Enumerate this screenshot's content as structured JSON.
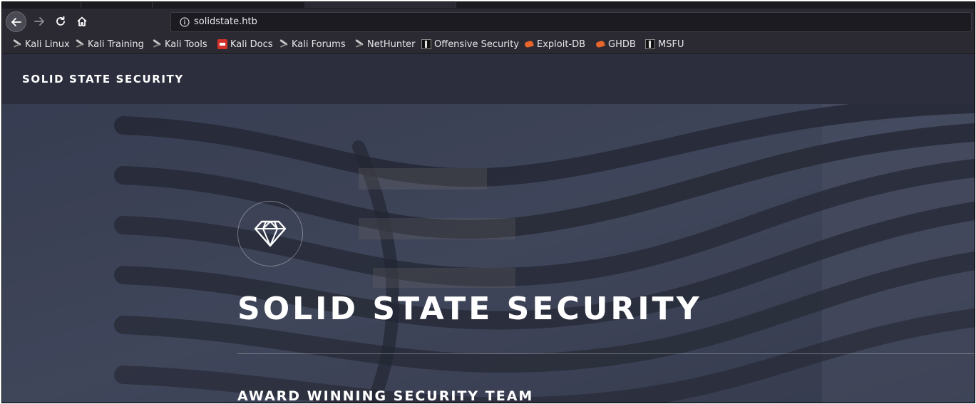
{
  "browser": {
    "url": "solidstate.htb",
    "bookmarks": [
      {
        "label": "Kali Linux",
        "icon": "kali-dragon-icon"
      },
      {
        "label": "Kali Training",
        "icon": "kali-dragon-icon"
      },
      {
        "label": "Kali Tools",
        "icon": "kali-dragon-icon"
      },
      {
        "label": "Kali Docs",
        "icon": "kali-docs-icon"
      },
      {
        "label": "Kali Forums",
        "icon": "kali-dragon-icon"
      },
      {
        "label": "NetHunter",
        "icon": "nethunter-icon"
      },
      {
        "label": "Offensive Security",
        "icon": "offensive-security-icon"
      },
      {
        "label": "Exploit-DB",
        "icon": "exploit-db-icon"
      },
      {
        "label": "GHDB",
        "icon": "exploit-db-icon"
      },
      {
        "label": "MSFU",
        "icon": "offensive-security-icon"
      }
    ]
  },
  "site": {
    "header_title": "SOLID STATE SECURITY",
    "hero": {
      "icon": "diamond-icon",
      "title": "SOLID STATE SECURITY",
      "subtitle": "AWARD WINNING SECURITY TEAM"
    }
  },
  "colors": {
    "browser_chrome": "#2b2a33",
    "site_header": "#2c2e3d",
    "hero_overlay": "#2f3444"
  }
}
